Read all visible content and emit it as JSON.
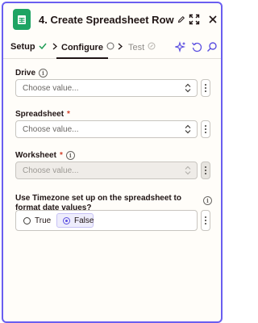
{
  "header": {
    "title": "4. Create Spreadsheet Row"
  },
  "tabs": [
    {
      "label": "Setup",
      "state": "complete"
    },
    {
      "label": "Configure",
      "state": "active"
    },
    {
      "label": "Test",
      "state": "disabled"
    }
  ],
  "fields": {
    "drive": {
      "label": "Drive",
      "placeholder": "Choose value..."
    },
    "spreadsheet": {
      "label": "Spreadsheet",
      "required_mark": "*",
      "placeholder": "Choose value..."
    },
    "worksheet": {
      "label": "Worksheet",
      "required_mark": "*",
      "placeholder": "Choose value..."
    },
    "timezone": {
      "label": "Use Timezone set up on the spreadsheet to format date values?",
      "options": [
        "True",
        "False"
      ],
      "selected": "False"
    }
  },
  "colors": {
    "accent": "#6a5ef0",
    "sheets_green": "#1fa463",
    "success_green": "#1f9d55",
    "required_red": "#d2412b"
  },
  "icons": {
    "app": "google-sheets-icon",
    "edit": "pencil-icon",
    "expand": "expand-icon",
    "close": "close-icon",
    "ai": "sparkle-icon",
    "refresh": "undo-icon",
    "search": "search-icon"
  }
}
